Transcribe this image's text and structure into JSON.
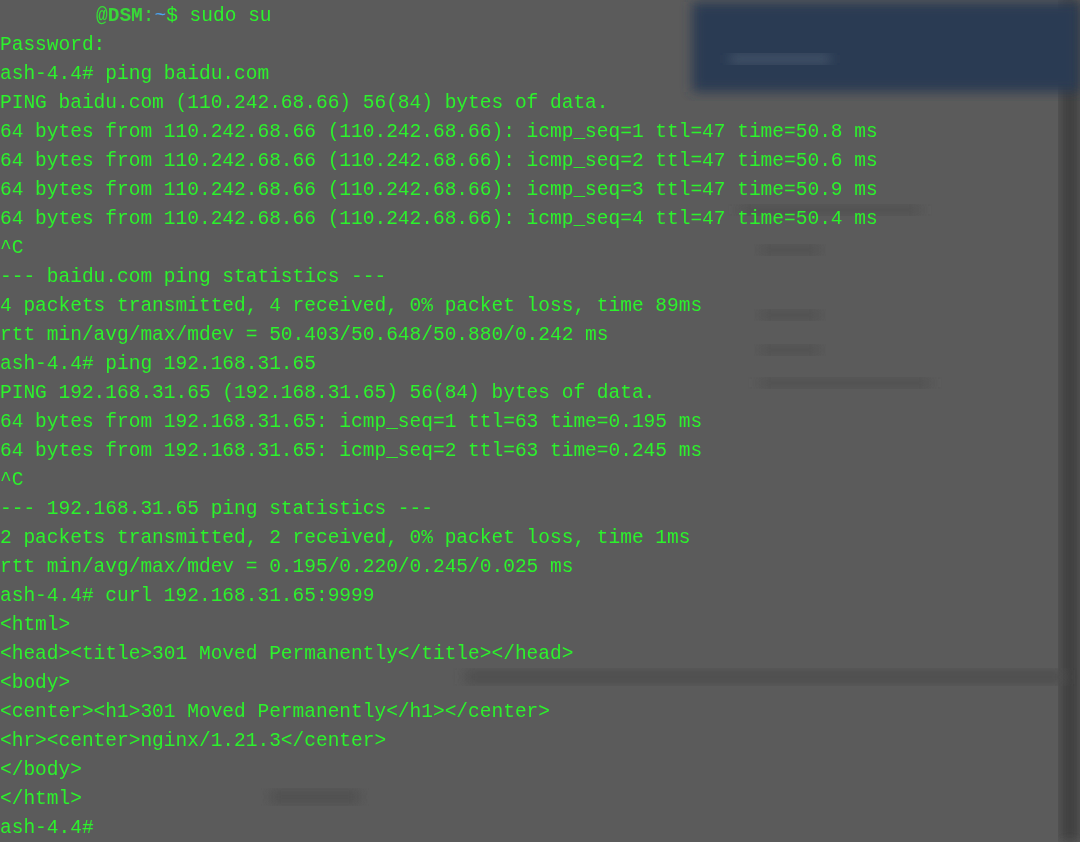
{
  "terminal": {
    "lines": [
      {
        "kind": "prompt",
        "host": "@DSM",
        "separator": ":",
        "path": "~",
        "command": "$ sudo su"
      },
      {
        "kind": "output",
        "text": "Password:"
      },
      {
        "kind": "output",
        "text": "ash-4.4# ping baidu.com"
      },
      {
        "kind": "output",
        "text": "PING baidu.com (110.242.68.66) 56(84) bytes of data."
      },
      {
        "kind": "output",
        "text": "64 bytes from 110.242.68.66 (110.242.68.66): icmp_seq=1 ttl=47 time=50.8 ms"
      },
      {
        "kind": "output",
        "text": "64 bytes from 110.242.68.66 (110.242.68.66): icmp_seq=2 ttl=47 time=50.6 ms"
      },
      {
        "kind": "output",
        "text": "64 bytes from 110.242.68.66 (110.242.68.66): icmp_seq=3 ttl=47 time=50.9 ms"
      },
      {
        "kind": "output",
        "text": "64 bytes from 110.242.68.66 (110.242.68.66): icmp_seq=4 ttl=47 time=50.4 ms"
      },
      {
        "kind": "output",
        "text": "^C"
      },
      {
        "kind": "output",
        "text": "--- baidu.com ping statistics ---"
      },
      {
        "kind": "output",
        "text": "4 packets transmitted, 4 received, 0% packet loss, time 89ms"
      },
      {
        "kind": "output",
        "text": "rtt min/avg/max/mdev = 50.403/50.648/50.880/0.242 ms"
      },
      {
        "kind": "output",
        "text": "ash-4.4# ping 192.168.31.65"
      },
      {
        "kind": "output",
        "text": "PING 192.168.31.65 (192.168.31.65) 56(84) bytes of data."
      },
      {
        "kind": "output",
        "text": "64 bytes from 192.168.31.65: icmp_seq=1 ttl=63 time=0.195 ms"
      },
      {
        "kind": "output",
        "text": "64 bytes from 192.168.31.65: icmp_seq=2 ttl=63 time=0.245 ms"
      },
      {
        "kind": "output",
        "text": "^C"
      },
      {
        "kind": "output",
        "text": "--- 192.168.31.65 ping statistics ---"
      },
      {
        "kind": "output",
        "text": "2 packets transmitted, 2 received, 0% packet loss, time 1ms"
      },
      {
        "kind": "output",
        "text": "rtt min/avg/max/mdev = 0.195/0.220/0.245/0.025 ms"
      },
      {
        "kind": "output",
        "text": "ash-4.4# curl 192.168.31.65:9999"
      },
      {
        "kind": "output",
        "text": "<html>"
      },
      {
        "kind": "output",
        "text": "<head><title>301 Moved Permanently</title></head>"
      },
      {
        "kind": "output",
        "text": "<body>"
      },
      {
        "kind": "output",
        "text": "<center><h1>301 Moved Permanently</h1></center>"
      },
      {
        "kind": "output",
        "text": "<hr><center>nginx/1.21.3</center>"
      },
      {
        "kind": "output",
        "text": "</body>"
      },
      {
        "kind": "output",
        "text": "</html>"
      },
      {
        "kind": "output",
        "text": "ash-4.4#"
      }
    ]
  }
}
